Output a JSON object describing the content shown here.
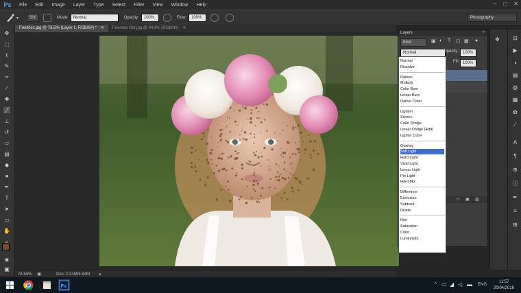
{
  "app": {
    "logo": "Ps"
  },
  "menu": [
    "File",
    "Edit",
    "Image",
    "Layer",
    "Type",
    "Select",
    "Filter",
    "View",
    "Window",
    "Help"
  ],
  "window_controls": [
    "–",
    "□",
    "✕"
  ],
  "options_bar": {
    "brush_size": "500",
    "mode_label": "Mode:",
    "mode_value": "Normal",
    "opacity_label": "Opacity:",
    "opacity_value": "100%",
    "flow_label": "Flow:",
    "flow_value": "100%",
    "workspace": "Photography"
  },
  "tabs": [
    {
      "label": "Freckles.jpg @ 78.5% (Layer 1, RGB/8#) *",
      "close": "✕"
    },
    {
      "label": "Freckles Girl.jpg @ 94.8% (RGB/8#)",
      "close": "✕"
    }
  ],
  "status": {
    "zoom": "78.53%",
    "doc": "Doc: 2.21M/4.84M"
  },
  "layers_panel": {
    "title": "Layers",
    "filter_value": "Kind",
    "blend_value": "Normal",
    "opacity_label": "Opacity:",
    "opacity_value": "100%",
    "fill_label": "Fill:",
    "fill_value": "100%"
  },
  "blend_modes": [
    [
      "Normal",
      "Dissolve"
    ],
    [
      "Darken",
      "Multiply",
      "Color Burn",
      "Linear Burn",
      "Darker Color"
    ],
    [
      "Lighten",
      "Screen",
      "Color Dodge",
      "Linear Dodge (Add)",
      "Lighter Color"
    ],
    [
      "Overlay",
      "Soft Light",
      "Hard Light",
      "Vivid Light",
      "Linear Light",
      "Pin Light",
      "Hard Mix"
    ],
    [
      "Difference",
      "Exclusion",
      "Subtract",
      "Divide"
    ],
    [
      "Hue",
      "Saturation",
      "Color",
      "Luminosity"
    ]
  ],
  "blend_selected": "Soft Light",
  "taskbar": {
    "lang": "ENG",
    "time": "11:57",
    "date": "20/04/2016"
  },
  "colors": {
    "accent": "#3f6fd6",
    "ps_blue": "#4aa3ff",
    "foreground": "#7a4a28",
    "background": "#ffffff"
  }
}
